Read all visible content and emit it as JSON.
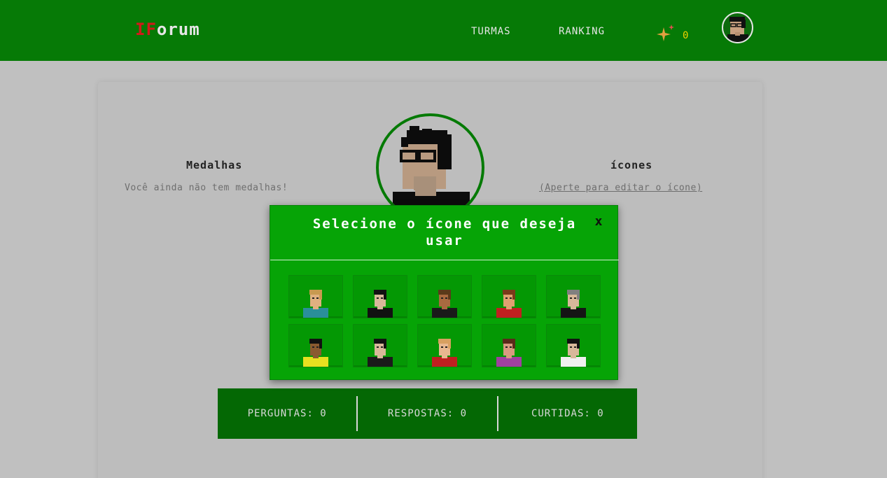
{
  "header": {
    "logo_prefix": "IF",
    "logo_rest": "orum",
    "nav": {
      "turmas": "TURMAS",
      "ranking": "RANKING"
    },
    "points": "0",
    "colors": {
      "bar": "#067a06",
      "logo_prefix": "#d11a1a",
      "points": "#f0d100"
    }
  },
  "profile": {
    "medals": {
      "title": "Medalhas",
      "empty_text": "Você ainda não tem medalhas!"
    },
    "icons": {
      "title": "ícones",
      "edit_hint": "(Aperte para editar o ícone)"
    }
  },
  "stats": {
    "perguntas": {
      "label": "PERGUNTAS",
      "value": "0"
    },
    "respostas": {
      "label": "RESPOSTAS",
      "value": "0"
    },
    "curtidas": {
      "label": "CURTIDAS",
      "value": "0"
    }
  },
  "modal": {
    "title": "Selecione o ícone que deseja usar",
    "close": "x",
    "options": [
      {
        "name": "avatar-blond-teal-shirt-icon",
        "skin": "#e0b080",
        "hair": "#c89a50",
        "shirt": "#2a8f9a"
      },
      {
        "name": "avatar-glasses-black-hair-icon",
        "skin": "#d8b89a",
        "hair": "#111111",
        "shirt": "#111111"
      },
      {
        "name": "avatar-sunglasses-beard-icon",
        "skin": "#a86a40",
        "hair": "#5a3a1a",
        "shirt": "#1a1a1a"
      },
      {
        "name": "avatar-curly-red-shirt-icon",
        "skin": "#e0a070",
        "hair": "#7a3a1a",
        "shirt": "#c02020"
      },
      {
        "name": "avatar-gray-hair-icon",
        "skin": "#d8b89a",
        "hair": "#808080",
        "shirt": "#151515"
      },
      {
        "name": "avatar-afro-yellow-shirt-icon",
        "skin": "#8a5a30",
        "hair": "#111111",
        "shirt": "#e8e020"
      },
      {
        "name": "avatar-long-black-hair-icon",
        "skin": "#d8b89a",
        "hair": "#111111",
        "shirt": "#1a1a1a"
      },
      {
        "name": "avatar-blonde-red-shirt-icon",
        "skin": "#e8b890",
        "hair": "#d8a060",
        "shirt": "#c02020"
      },
      {
        "name": "avatar-brown-hair-purple-icon",
        "skin": "#d89a80",
        "hair": "#5a2a1a",
        "shirt": "#a040a0"
      },
      {
        "name": "avatar-doctor-mustache-icon",
        "skin": "#d8b89a",
        "hair": "#111111",
        "shirt": "#f0f0f0"
      }
    ]
  }
}
